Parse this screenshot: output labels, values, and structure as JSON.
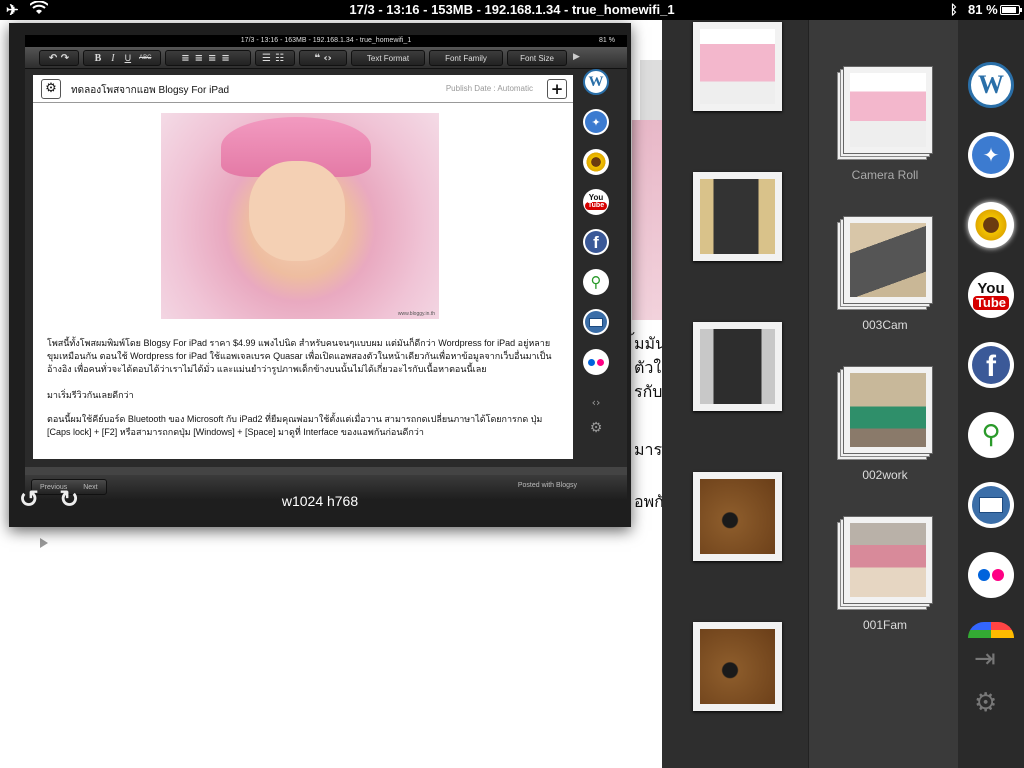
{
  "status_bar": {
    "text": "17/3 - 13:16 - 153MB - 192.168.1.34 - true_homewifi_1",
    "battery": "81 %"
  },
  "screenshot_window": {
    "mini_status": "17/3 - 13:16 - 163MB - 192.168.1.34 - true_homewifi_1",
    "mini_battery": "81 %",
    "toolbar": {
      "bold": "B",
      "italic": "I",
      "underline": "U",
      "strike": "ABC",
      "text_format": "Text Format",
      "font_family": "Font Family",
      "font_size": "Font Size"
    },
    "doc": {
      "title": "ทดลองโพสจากแอพ Blogsy For iPad",
      "publish_date": "Publish Date : Automatic",
      "image_watermark": "www.bloggy.in.th",
      "paragraph1": "โพสนี้ทั้งโพสผมพิมพ์โดย Blogsy For iPad ราคา $4.99 แพงไปนิด สำหรับคนจนๆแบบผม แต่มันก็ดีกว่า Wordpress for iPad อยู่หลายขุมเหมือนกัน ตอนใช้ Wordpress for iPad ใช้แอพเจลเบรค Quasar เพื่อเปิดแอพสองตัวในหน้าเดียวกันเพื่อหาข้อมูลจากเว็บอื่นมาเป็นอ้างอิง เพื่อคนทั่วจะได้ตอบได้ว่าเราไม่ได้มั่ว และแม่นยำว่ารูปภาพเด็กข้างบนนั้นไม่ได้เกี่ยวอะไรกับเนื้อหาตอนนี้เลย",
      "paragraph2": "มาเริ่มรีวิวกันเลยดีกว่า",
      "paragraph3": "ตอนนี้ผมใช้คีย์บอร์ด Bluetooth ของ Microsoft กับ iPad2 ที่ยืมคุณพ่อมาใช้ตั้งแต่เมื่อวาน สามารถกดเปลี่ยนภาษาได้โดยการกด ปุ่ม [Caps lock] + [F2] หรือสามารถกดปุ่ม [Windows] + [Space] มาดูที่ Interface ของแอพกันก่อนดีกว่า"
    },
    "footer": {
      "previous": "Previous",
      "next": "Next",
      "posted": "Posted with Blogsy"
    },
    "dimensions": "w1024 h768"
  },
  "background_page": {
    "frag1": "้มมันก็",
    "frag2": "ตัวใน",
    "frag3": "รกับเ",
    "frag4": "มาร",
    "frag5": "อพกั"
  },
  "albums": [
    {
      "label": "Camera Roll",
      "image": "blog-screenshot"
    },
    {
      "label": "003Cam",
      "image": "ipad-cover"
    },
    {
      "label": "002work",
      "image": "office-photo"
    },
    {
      "label": "001Fam",
      "image": "family-photo"
    }
  ],
  "photo_roll": [
    {
      "image": "blog-screenshot"
    },
    {
      "image": "maps-screenshot"
    },
    {
      "image": "settings-screenshot"
    },
    {
      "image": "desk-photo"
    },
    {
      "image": "desk-photo"
    }
  ],
  "right_icons": [
    "wordpress-icon",
    "safari-icon",
    "sunflower-icon",
    "youtube-icon",
    "facebook-icon",
    "search-icon",
    "mail-icon",
    "flickr-icon",
    "picasa-icon",
    "import-icon",
    "settings-icon"
  ],
  "colors": {
    "wordpress_blue": "#2a6fa8",
    "facebook_blue": "#3b5998",
    "youtube_red": "#d60000"
  }
}
